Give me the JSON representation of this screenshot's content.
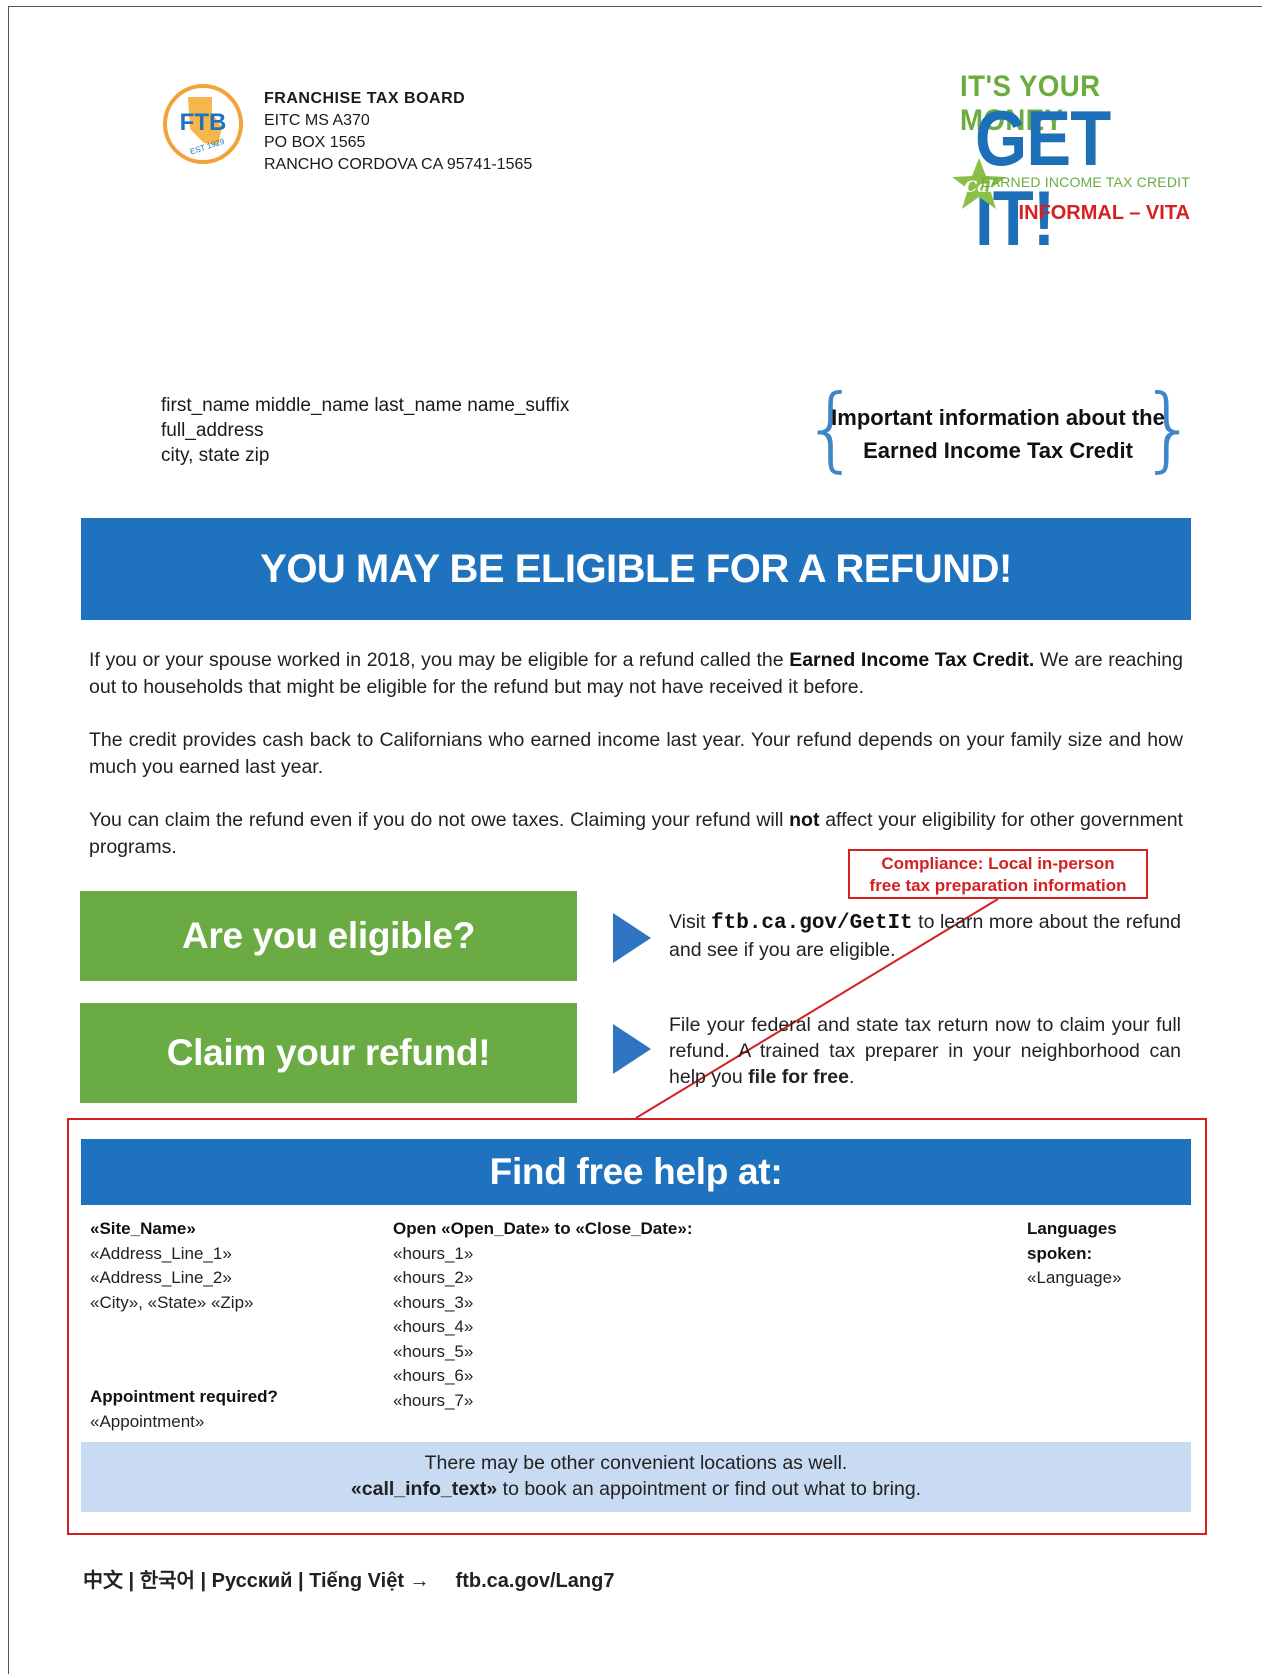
{
  "ftb": {
    "logo_text": "FTB",
    "logo_est": "EST 1929",
    "address": [
      "FRANCHISE TAX BOARD",
      "EITC MS A370",
      "PO BOX 1565",
      "RANCHO CORDOVA CA 95741-1565"
    ]
  },
  "brand": {
    "tagline": "IT'S YOUR MONEY",
    "headline": "GET IT!",
    "cal": "Cal",
    "subline": "EARNED INCOME TAX CREDIT",
    "version": "INFORMAL – VITA"
  },
  "recipient": [
    "first_name middle_name last_name name_suffix",
    "full_address",
    "city, state zip"
  ],
  "info_box": [
    "Important information about the",
    "Earned Income Tax Credit"
  ],
  "headline": "YOU MAY BE ELIGIBLE FOR A REFUND!",
  "paragraphs": {
    "p1_a": "If you or your spouse worked in 2018, you may be eligible for a refund called the ",
    "p1_b": "Earned Income Tax Credit.",
    "p1_c": " We are reaching out to households that might be eligible for the refund but may not have received it before.",
    "p2": "The credit provides cash back to Californians who earned income last year. Your refund depends on your family size and how much you earned last year.",
    "p3_a": "You can claim the refund even if you do not owe taxes. Claiming your refund will ",
    "p3_b": "not",
    "p3_c": " affect your eligibility for other government programs."
  },
  "compliance": [
    "Compliance: Local in-person",
    "free tax preparation information"
  ],
  "actions": {
    "eligible": "Are you eligible?",
    "claim": "Claim your refund!",
    "eligible_text_a": "Visit ",
    "eligible_url": "ftb.ca.gov/GetIt",
    "eligible_text_b": " to learn more about the refund and see if you are eligible.",
    "claim_text_a": "File your federal and state tax return now to claim your full refund. A trained tax preparer in your neighborhood can help you ",
    "claim_text_b": "file for free",
    "claim_text_c": "."
  },
  "help": {
    "title": "Find free help at:",
    "site_name": "«Site_Name»",
    "address_lines": [
      "«Address_Line_1»",
      "«Address_Line_2»",
      "«City», «State» «Zip»"
    ],
    "hours_header": "Open «Open_Date» to «Close_Date»:",
    "hours": [
      "«hours_1»",
      "«hours_2»",
      "«hours_3»",
      "«hours_4»",
      "«hours_5»",
      "«hours_6»",
      "«hours_7»"
    ],
    "languages_header_1": "Languages",
    "languages_header_2": "spoken:",
    "language": "«Language»",
    "appointment_label": "Appointment required?",
    "appointment_value": "«Appointment»",
    "note_line1": "There may be other convenient locations as well.",
    "note_call": "«call_info_text»",
    "note_line2": " to book an appointment or find out what to bring."
  },
  "languages": {
    "list": "中文 | 한국어 | Русский | Tiếng Việt →",
    "url": "ftb.ca.gov/Lang7"
  },
  "colors": {
    "blue": "#1f72bd",
    "green": "#6aab43",
    "red": "#d42020",
    "light_blue": "#c9daf3"
  }
}
